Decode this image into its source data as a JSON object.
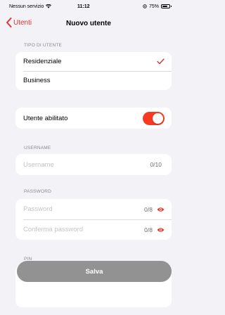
{
  "status_bar": {
    "carrier": "Nessun servizio",
    "time": "11:12",
    "battery": "75%"
  },
  "nav": {
    "back_label": "Utenti",
    "title": "Nuovo utente"
  },
  "user_type": {
    "section_label": "TIPO DI UTENTE",
    "options": [
      {
        "label": "Residenziale",
        "selected": true
      },
      {
        "label": "Business",
        "selected": false
      }
    ]
  },
  "enabled": {
    "label": "Utente abilitato",
    "value": true
  },
  "username": {
    "section_label": "USERNAME",
    "placeholder": "Username",
    "counter": "0/10"
  },
  "password": {
    "section_label": "PASSWORD",
    "password_placeholder": "Password",
    "password_counter": "0/8",
    "confirm_placeholder": "Conferma password",
    "confirm_counter": "0/8"
  },
  "pin": {
    "section_label": "PIN"
  },
  "save_label": "Salva",
  "colors": {
    "accent": "#e5322d",
    "toggle_on": "#f93a22",
    "button_disabled": "#929292",
    "background": "#f2f2f7"
  }
}
